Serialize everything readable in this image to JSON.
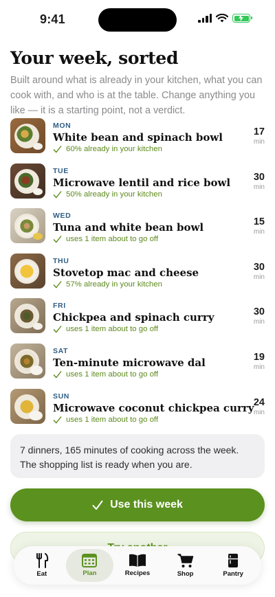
{
  "status": {
    "time": "9:41"
  },
  "header": {
    "title": "Your week, sorted",
    "subtitle": "Built around what is already in your kitchen, what you can cook with, and who is at the table. Change anything you like — it is a starting point, not a verdict."
  },
  "meals": [
    {
      "day": "MON",
      "name": "White bean and spinach bowl",
      "note": "60% already in your kitchen",
      "minutes": "17",
      "unit": "min",
      "photo": "bean-spinach-bowl-photo"
    },
    {
      "day": "TUE",
      "name": "Microwave lentil and rice bowl",
      "note": "50% already in your kitchen",
      "minutes": "30",
      "unit": "min",
      "photo": "lentil-rice-bowl-photo"
    },
    {
      "day": "WED",
      "name": "Tuna and white bean bowl",
      "note": "uses 1 item about to go off",
      "minutes": "15",
      "unit": "min",
      "photo": "tuna-bean-bowl-photo"
    },
    {
      "day": "THU",
      "name": "Stovetop mac and cheese",
      "note": "57% already in your kitchen",
      "minutes": "30",
      "unit": "min",
      "photo": "mac-cheese-photo"
    },
    {
      "day": "FRI",
      "name": "Chickpea and spinach curry",
      "note": "uses 1 item about to go off",
      "minutes": "30",
      "unit": "min",
      "photo": "chickpea-curry-photo"
    },
    {
      "day": "SAT",
      "name": "Ten-minute microwave dal",
      "note": "uses 1 item about to go off",
      "minutes": "19",
      "unit": "min",
      "photo": "dal-photo"
    },
    {
      "day": "SUN",
      "name": "Microwave coconut chickpea curry",
      "note": "uses 1 item about to go off",
      "minutes": "24",
      "unit": "min",
      "photo": "coconut-chickpea-curry-photo"
    }
  ],
  "summary": {
    "line1": "7 dinners, 165 minutes of cooking across the week.",
    "line2": "The shopping list is ready when you are."
  },
  "actions": {
    "primary_label": "Use this week",
    "secondary_label": "Try another"
  },
  "tabs": [
    {
      "label": "Eat",
      "icon": "fork-knife-icon"
    },
    {
      "label": "Plan",
      "icon": "calendar-icon",
      "active": true
    },
    {
      "label": "Recipes",
      "icon": "book-icon"
    },
    {
      "label": "Shop",
      "icon": "cart-icon"
    },
    {
      "label": "Pantry",
      "icon": "fridge-icon"
    }
  ],
  "colors": {
    "accent": "#5b911f",
    "day_label": "#2f5d84",
    "note": "#5c8a1c"
  }
}
